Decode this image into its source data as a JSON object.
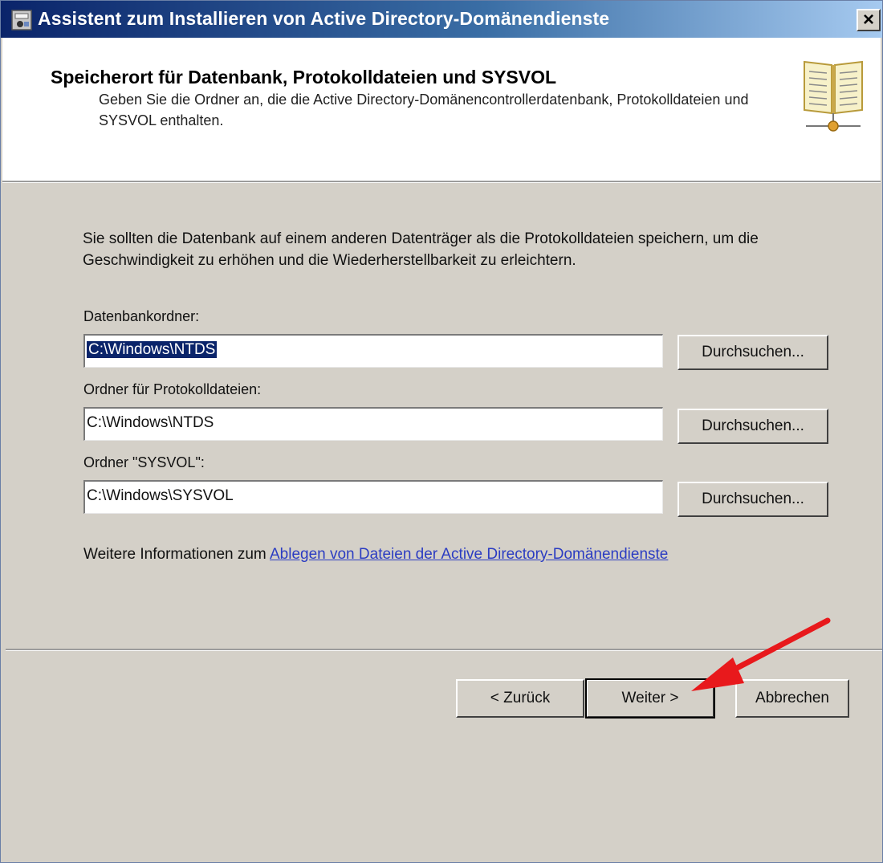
{
  "window": {
    "title": "Assistent zum Installieren von Active Directory-Domänendienste",
    "close_symbol": "×"
  },
  "header": {
    "title": "Speicherort für Datenbank, Protokolldateien und SYSVOL",
    "description": "Geben Sie die Ordner an, die die Active Directory-Domänencontrollerdatenbank, Protokolldateien und SYSVOL enthalten.",
    "icon": "book-icon"
  },
  "intro": "Sie sollten die Datenbank auf einem anderen Datenträger als die Protokolldateien speichern, um die Geschwindigkeit zu erhöhen und die Wiederherstellbarkeit zu erleichtern.",
  "fields": {
    "database": {
      "label": "Datenbankordner:",
      "value": "C:\\Windows\\NTDS",
      "button": "Durchsuchen..."
    },
    "logs": {
      "label": "Ordner für Protokolldateien:",
      "value": "C:\\Windows\\NTDS",
      "button": "Durchsuchen..."
    },
    "sysvol": {
      "label": "Ordner \"SYSVOL\":",
      "value": "C:\\Windows\\SYSVOL",
      "button": "Durchsuchen..."
    }
  },
  "more_info": {
    "prefix": "Weitere Informationen zum ",
    "link": "Ablegen von Dateien der Active Directory-Domänendienste"
  },
  "footer": {
    "back": "< Zurück",
    "next": "Weiter >",
    "cancel": "Abbrechen"
  },
  "colors": {
    "titlebar": "#0a246a",
    "selection": "#0a246a",
    "link": "#2b3cc2",
    "annotation_arrow": "#e8191c"
  }
}
